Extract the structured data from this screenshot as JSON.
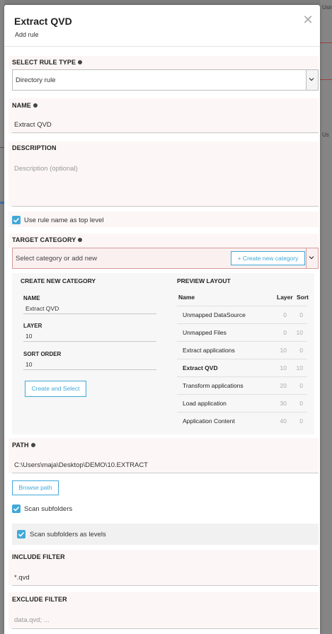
{
  "background": {
    "right_text_1": "Usin",
    "right_text_2": "Us"
  },
  "modal": {
    "title": "Extract QVD",
    "subtitle": "Add rule",
    "close_glyph": "✕"
  },
  "rule_type": {
    "label": "SELECT RULE TYPE",
    "value": "Directory rule"
  },
  "name": {
    "label": "NAME",
    "value": "Extract QVD"
  },
  "description": {
    "label": "DESCRIPTION",
    "placeholder": "Description (optional)"
  },
  "use_rule_name": {
    "label": "Use rule name as top level",
    "checked": true
  },
  "target_category": {
    "label": "TARGET CATEGORY",
    "placeholder": "Select category or add new",
    "new_button": "+ Create new category"
  },
  "create_category": {
    "heading": "CREATE NEW CATEGORY",
    "name_label": "NAME",
    "name_value": "Extract QVD",
    "layer_label": "LAYER",
    "layer_value": "10",
    "sort_label": "SORT ORDER",
    "sort_value": "10",
    "button": "Create and Select"
  },
  "preview": {
    "heading": "PREVIEW LAYOUT",
    "columns": [
      "Name",
      "Layer",
      "Sort"
    ],
    "rows": [
      {
        "name": "Unmapped DataSource",
        "layer": "0",
        "sort": "0",
        "bold": false
      },
      {
        "name": "Unmapped Files",
        "layer": "0",
        "sort": "10",
        "bold": false
      },
      {
        "name": "Extract applications",
        "layer": "10",
        "sort": "0",
        "bold": false
      },
      {
        "name": "Extract QVD",
        "layer": "10",
        "sort": "10",
        "bold": true
      },
      {
        "name": "Transform applications",
        "layer": "20",
        "sort": "0",
        "bold": false
      },
      {
        "name": "Load application",
        "layer": "30",
        "sort": "0",
        "bold": false
      },
      {
        "name": "Application Content",
        "layer": "40",
        "sort": "0",
        "bold": false
      }
    ]
  },
  "path": {
    "label": "PATH",
    "value": "C:\\Users\\maja\\Desktop\\DEMO\\10.EXTRACT",
    "browse_button": "Browse path"
  },
  "scan_subfolders": {
    "label": "Scan subfolders",
    "checked": true
  },
  "scan_levels": {
    "label": "Scan subfolders as levels",
    "checked": true
  },
  "include_filter": {
    "label": "INCLUDE FILTER",
    "value": "*.qvd"
  },
  "exclude_filter": {
    "label": "EXCLUDE FILTER",
    "placeholder": "data.qvd; ..."
  },
  "colors": {
    "accent": "#41a8d9",
    "error_border": "#d49c9c",
    "error_bg": "#fbf0f0"
  }
}
